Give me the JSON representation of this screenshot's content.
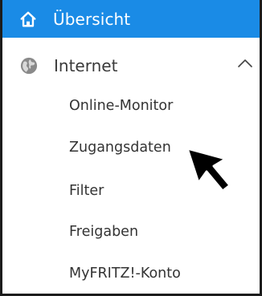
{
  "header": {
    "icon": "home-icon",
    "title": "Übersicht",
    "color": "#1a8be6"
  },
  "nav": {
    "internet": {
      "icon": "globe-icon",
      "label": "Internet",
      "expand_icon": "chevron-up-icon",
      "items": [
        {
          "label": "Online-Monitor"
        },
        {
          "label": "Zugangsdaten"
        },
        {
          "label": "Filter"
        },
        {
          "label": "Freigaben"
        },
        {
          "label": "MyFRITZ!-Konto"
        }
      ]
    }
  },
  "cursor": {
    "icon": "mouse-pointer-icon"
  }
}
